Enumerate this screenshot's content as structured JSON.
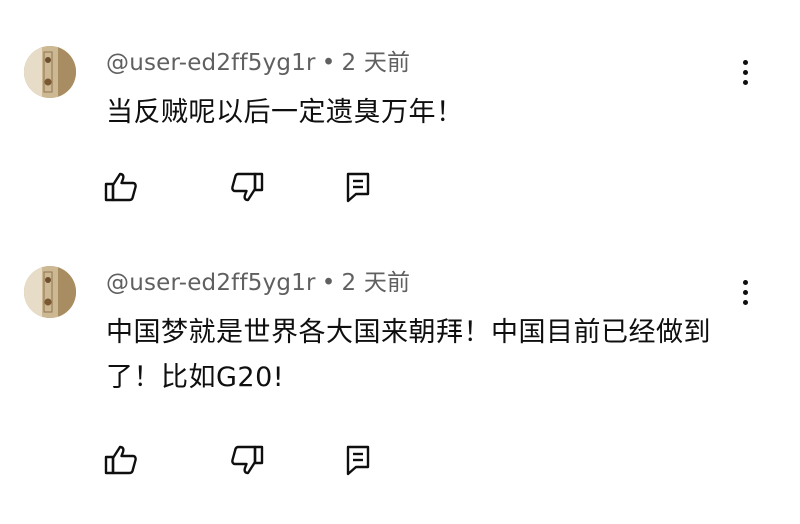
{
  "comments": [
    {
      "author": "@user-ed2ff5yg1r",
      "separator": "•",
      "time": "2 天前",
      "text": "当反贼呢以后一定遗臭万年！",
      "avatar_icon": "user-avatar-photo",
      "actions": [
        "like-icon",
        "dislike-icon",
        "reply-icon"
      ]
    },
    {
      "author": "@user-ed2ff5yg1r",
      "separator": "•",
      "time": "2 天前",
      "text": "中国梦就是世界各大国来朝拜！中国目前已经做到了！比如G20!",
      "avatar_icon": "user-avatar-photo",
      "actions": [
        "like-icon",
        "dislike-icon",
        "reply-icon"
      ]
    }
  ],
  "colors": {
    "text": "#0f0f0f",
    "meta": "#606060",
    "background": "#ffffff"
  }
}
